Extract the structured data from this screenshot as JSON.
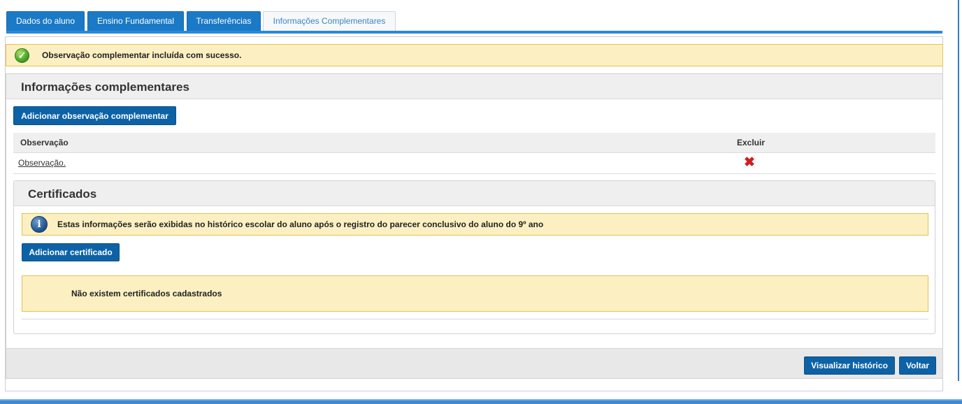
{
  "tabs": [
    {
      "label": "Dados do aluno",
      "active": false
    },
    {
      "label": "Ensino Fundamental",
      "active": false
    },
    {
      "label": "Transferências",
      "active": false
    },
    {
      "label": "Informações Complementares",
      "active": true
    }
  ],
  "success_alert": {
    "icon": "checkmark-circle-icon",
    "text": "Observação complementar incluída com sucesso."
  },
  "info_section": {
    "title": "Informações complementares",
    "add_button": "Adicionar observação complementar",
    "table": {
      "columns": [
        "Observação",
        "Excluir"
      ],
      "rows": [
        {
          "observacao": "Observação.",
          "delete_icon": "red-x-icon"
        }
      ]
    }
  },
  "certificates": {
    "title": "Certificados",
    "info_alert": {
      "icon": "info-icon",
      "text": "Estas informações serão exibidas no histórico escolar do aluno após o registro do parecer conclusivo do aluno do 9º ano"
    },
    "add_button": "Adicionar certificado",
    "empty_text": "Não existem certificados cadastrados"
  },
  "footer": {
    "view_history_button": "Visualizar histórico",
    "back_button": "Voltar"
  },
  "colors": {
    "primary": "#0d62a6",
    "tab_blue": "#1a7ac7",
    "alert_bg": "#fcf0c2",
    "alert_border": "#e6c252",
    "delete": "#cc1f1f"
  }
}
